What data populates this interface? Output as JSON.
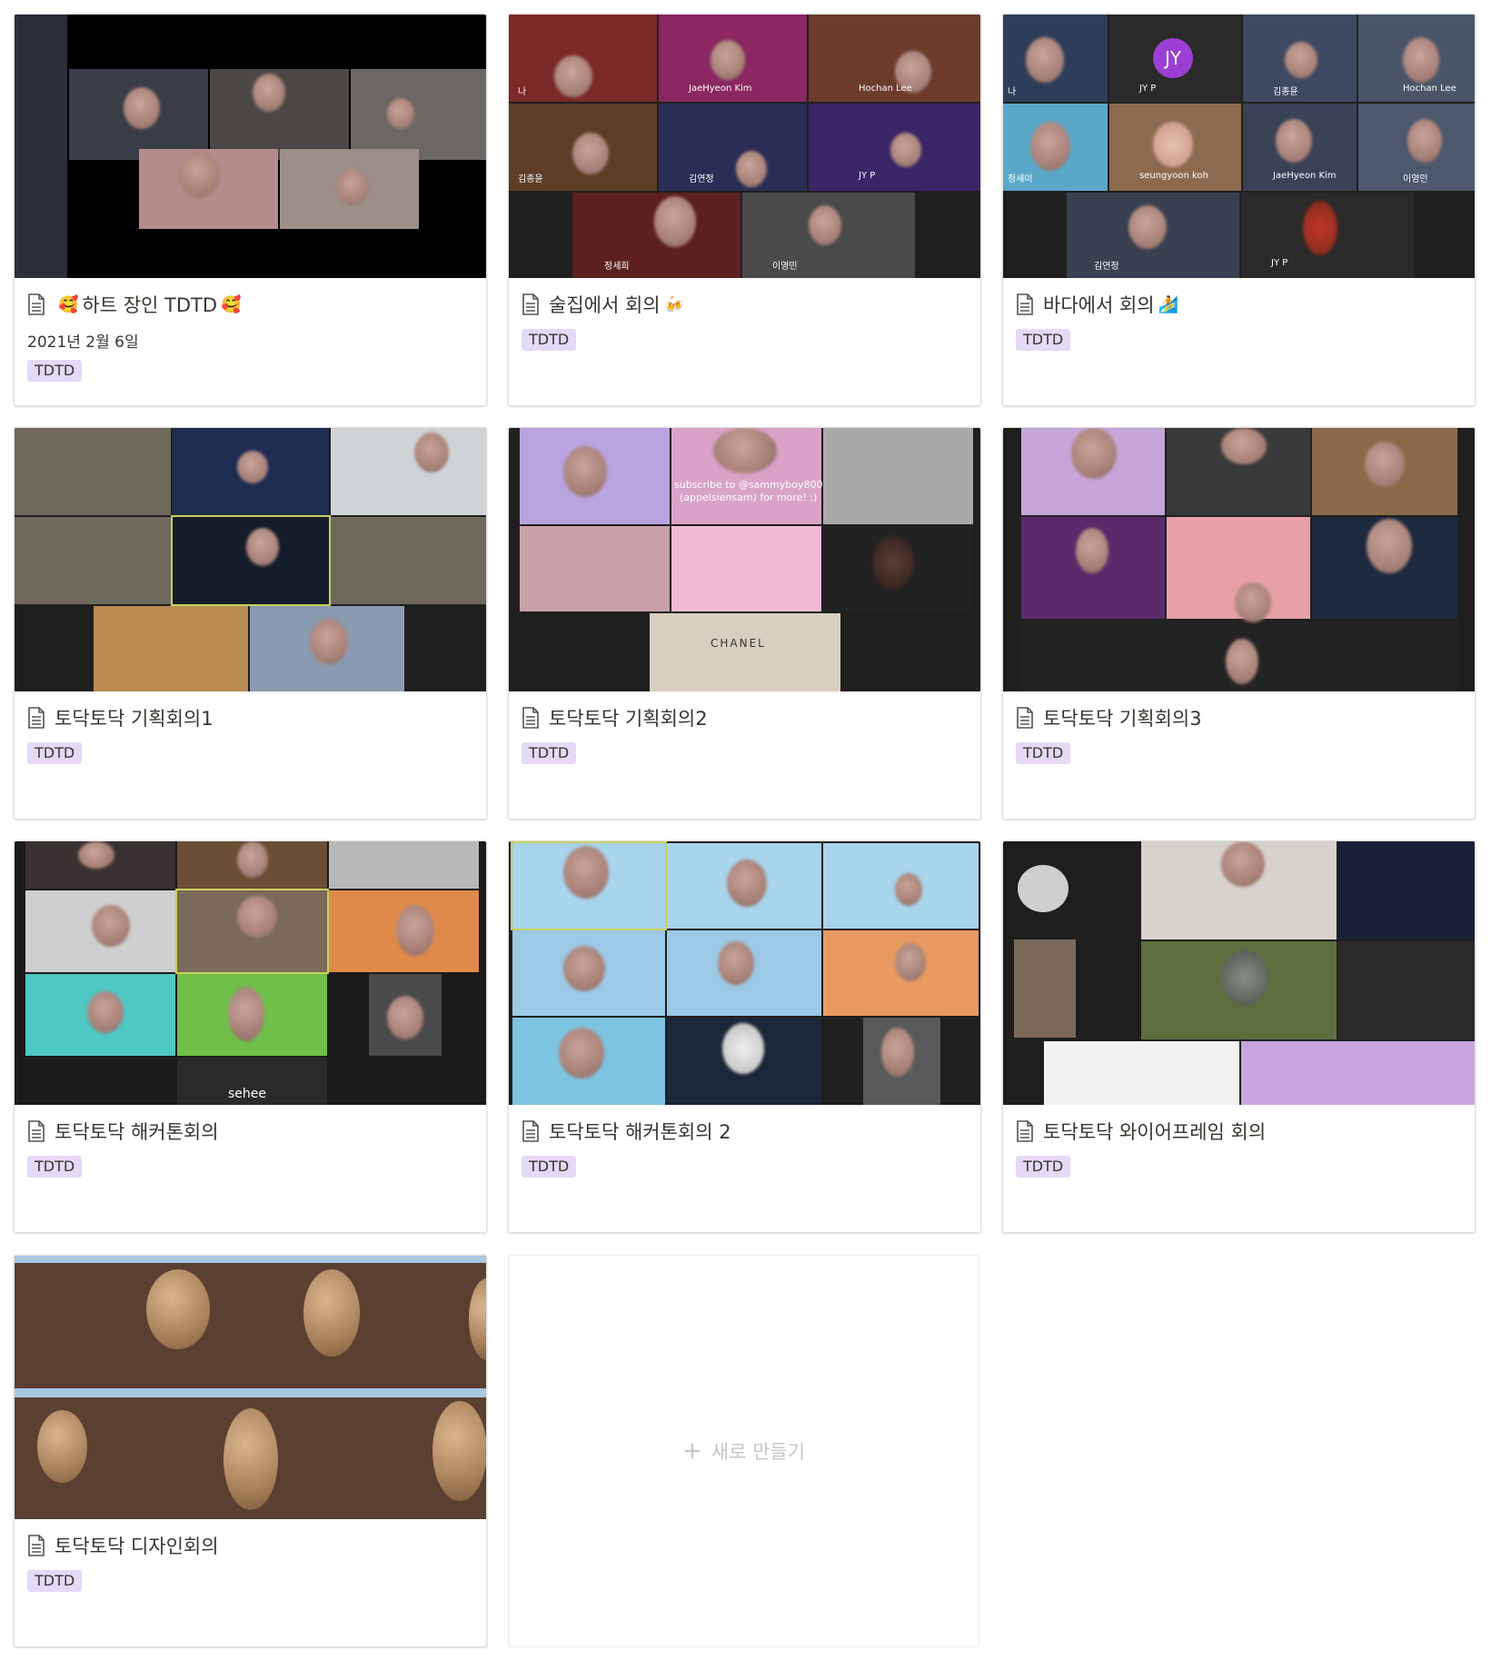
{
  "cards": [
    {
      "title_emoji_left": "🥰",
      "title": "하트 장인 TDTD",
      "title_emoji_right": "🥰",
      "date": "2021년 2월 6일",
      "tag": "TDTD"
    },
    {
      "title": "술집에서 회의",
      "title_emoji_right": "🍻",
      "tag": "TDTD"
    },
    {
      "title": "바다에서 회의",
      "title_emoji_right": "🏄",
      "tag": "TDTD"
    },
    {
      "title": "토닥토닥 기획회의1",
      "tag": "TDTD"
    },
    {
      "title": "토닥토닥 기획회의2",
      "tag": "TDTD"
    },
    {
      "title": "토닥토닥 기획회의3",
      "tag": "TDTD"
    },
    {
      "title": "토닥토닥 해커톤회의",
      "tag": "TDTD"
    },
    {
      "title": "토닥토닥 해커톤회의 2",
      "tag": "TDTD"
    },
    {
      "title": "토닥토닥 와이어프레임 회의",
      "tag": "TDTD"
    },
    {
      "title": "토닥토닥 디자인회의",
      "tag": "TDTD"
    }
  ],
  "thumb_labels": {
    "c2": [
      "나",
      "JaeHyeon Kim",
      "Hochan Lee",
      "김종윤",
      "김연정",
      "JY P",
      "정세희",
      "이영민"
    ],
    "c3": [
      "JY",
      "나",
      "JY P",
      "김종윤",
      "Hochan Lee",
      "정세미",
      "seungyoon koh",
      "JaeHyeon Kim",
      "이영민",
      "김연정",
      "JY P"
    ],
    "c5": [
      "subscribe to @sammyboy800",
      "(appelsiensam) for more! :)",
      "CHANEL"
    ],
    "c7": [
      "sehee"
    ]
  },
  "new_button": {
    "icon": "+",
    "label": "새로 만들기"
  }
}
